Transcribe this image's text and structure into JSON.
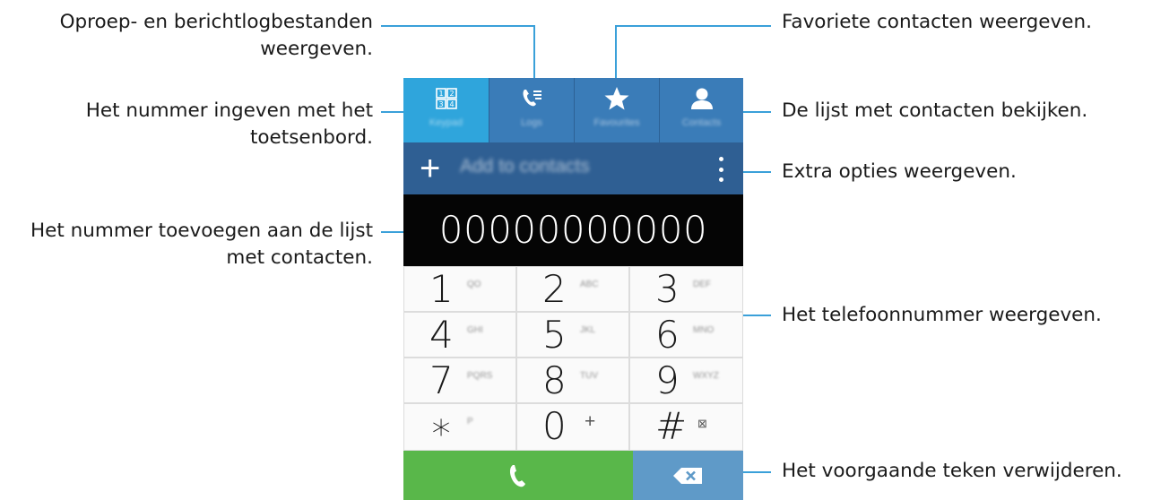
{
  "callouts": {
    "logs": "Oproep- en berichtlogbestanden",
    "logs_line2": "weergeven.",
    "keypad": "Het nummer ingeven met het",
    "keypad_line2": "toetsenbord.",
    "add_contact": "Het nummer toevoegen aan de lijst",
    "add_contact_line2": "met contacten.",
    "favourites": "Favoriete contacten weergeven.",
    "contacts": "De lijst met contacten bekijken.",
    "more_options": "Extra opties weergeven.",
    "number": "Het telefoonnummer weergeven.",
    "backspace": "Het voorgaande teken verwijderen."
  },
  "phone": {
    "tabs": [
      {
        "label": "Keypad",
        "icon": "keypad-icon"
      },
      {
        "label": "Logs",
        "icon": "call-log-icon"
      },
      {
        "label": "Favourites",
        "icon": "star-icon"
      },
      {
        "label": "Contacts",
        "icon": "person-icon"
      }
    ],
    "add_to_contacts": "Add to contacts",
    "plus_symbol": "+",
    "dialed_number": "00000000000",
    "keys": [
      {
        "digit": "1",
        "letters": "QO"
      },
      {
        "digit": "2",
        "letters": "ABC"
      },
      {
        "digit": "3",
        "letters": "DEF"
      },
      {
        "digit": "4",
        "letters": "GHI"
      },
      {
        "digit": "5",
        "letters": "JKL"
      },
      {
        "digit": "6",
        "letters": "MNO"
      },
      {
        "digit": "7",
        "letters": "PQRS"
      },
      {
        "digit": "8",
        "letters": "TUV"
      },
      {
        "digit": "9",
        "letters": "WXYZ"
      },
      {
        "digit": "∗",
        "letters": "P"
      },
      {
        "digit": "0",
        "letters": "+"
      },
      {
        "digit": "#",
        "letters": "⊠"
      }
    ],
    "colors": {
      "tab_bar": "#3a7cb8",
      "tab_active": "#2fa5dc",
      "add_bar": "#2f5f93",
      "display": "#050505",
      "call_button": "#59b74a",
      "delete_button": "#5f9ac8",
      "callout_line": "#3aa0d9"
    }
  }
}
